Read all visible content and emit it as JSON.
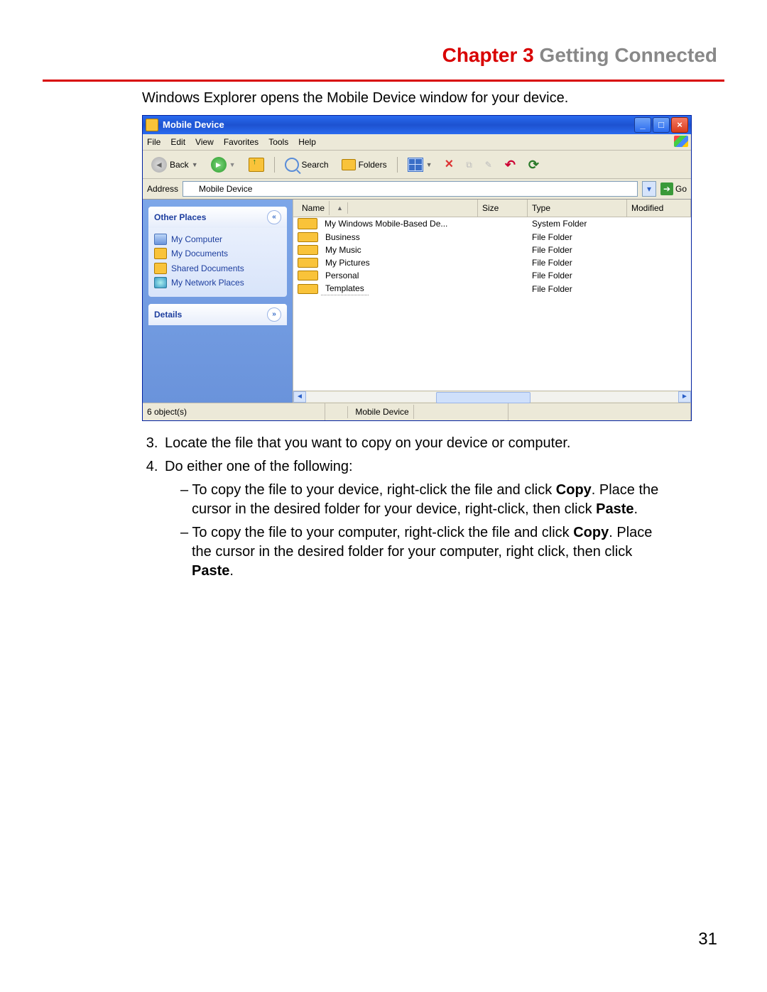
{
  "header": {
    "chapter": "Chapter 3",
    "title": "Getting Connected"
  },
  "intro": "Windows Explorer opens the Mobile Device window for your device.",
  "window": {
    "title": "Mobile Device",
    "menu": [
      "File",
      "Edit",
      "View",
      "Favorites",
      "Tools",
      "Help"
    ],
    "toolbar": {
      "back": "Back",
      "search": "Search",
      "folders": "Folders"
    },
    "address": {
      "label": "Address",
      "value": "Mobile Device",
      "go": "Go"
    },
    "sidebar": {
      "places_title": "Other Places",
      "places": [
        "My Computer",
        "My Documents",
        "Shared Documents",
        "My Network Places"
      ],
      "details_title": "Details"
    },
    "columns": [
      "Name",
      "Size",
      "Type",
      "Modified"
    ],
    "rows": [
      {
        "name": "My Windows Mobile-Based De...",
        "type": "System Folder",
        "icon": "device"
      },
      {
        "name": "Business",
        "type": "File Folder",
        "icon": "folder"
      },
      {
        "name": "My Music",
        "type": "File Folder",
        "icon": "folder"
      },
      {
        "name": "My Pictures",
        "type": "File Folder",
        "icon": "folder"
      },
      {
        "name": "Personal",
        "type": "File Folder",
        "icon": "folder"
      },
      {
        "name": "Templates",
        "type": "File Folder",
        "icon": "folder",
        "dotted": true
      }
    ],
    "status": {
      "left": "6 object(s)",
      "middle": "Mobile Device"
    }
  },
  "steps": {
    "s3": "Locate the file that you want to copy on your device or computer.",
    "s4": "Do either one of the following:",
    "b1a": "To copy the file to your device, right-click the file and click ",
    "b1b": "Copy",
    "b1c": ". Place the cursor in the desired folder for your device, right-click, then click ",
    "b1d": "Paste",
    "b1e": ".",
    "b2a": "To copy the file to your computer, right-click the file and click ",
    "b2b": "Copy",
    "b2c": ". Place the cursor in the desired folder for your computer, right click, then click ",
    "b2d": "Paste",
    "b2e": "."
  },
  "page_number": "31"
}
